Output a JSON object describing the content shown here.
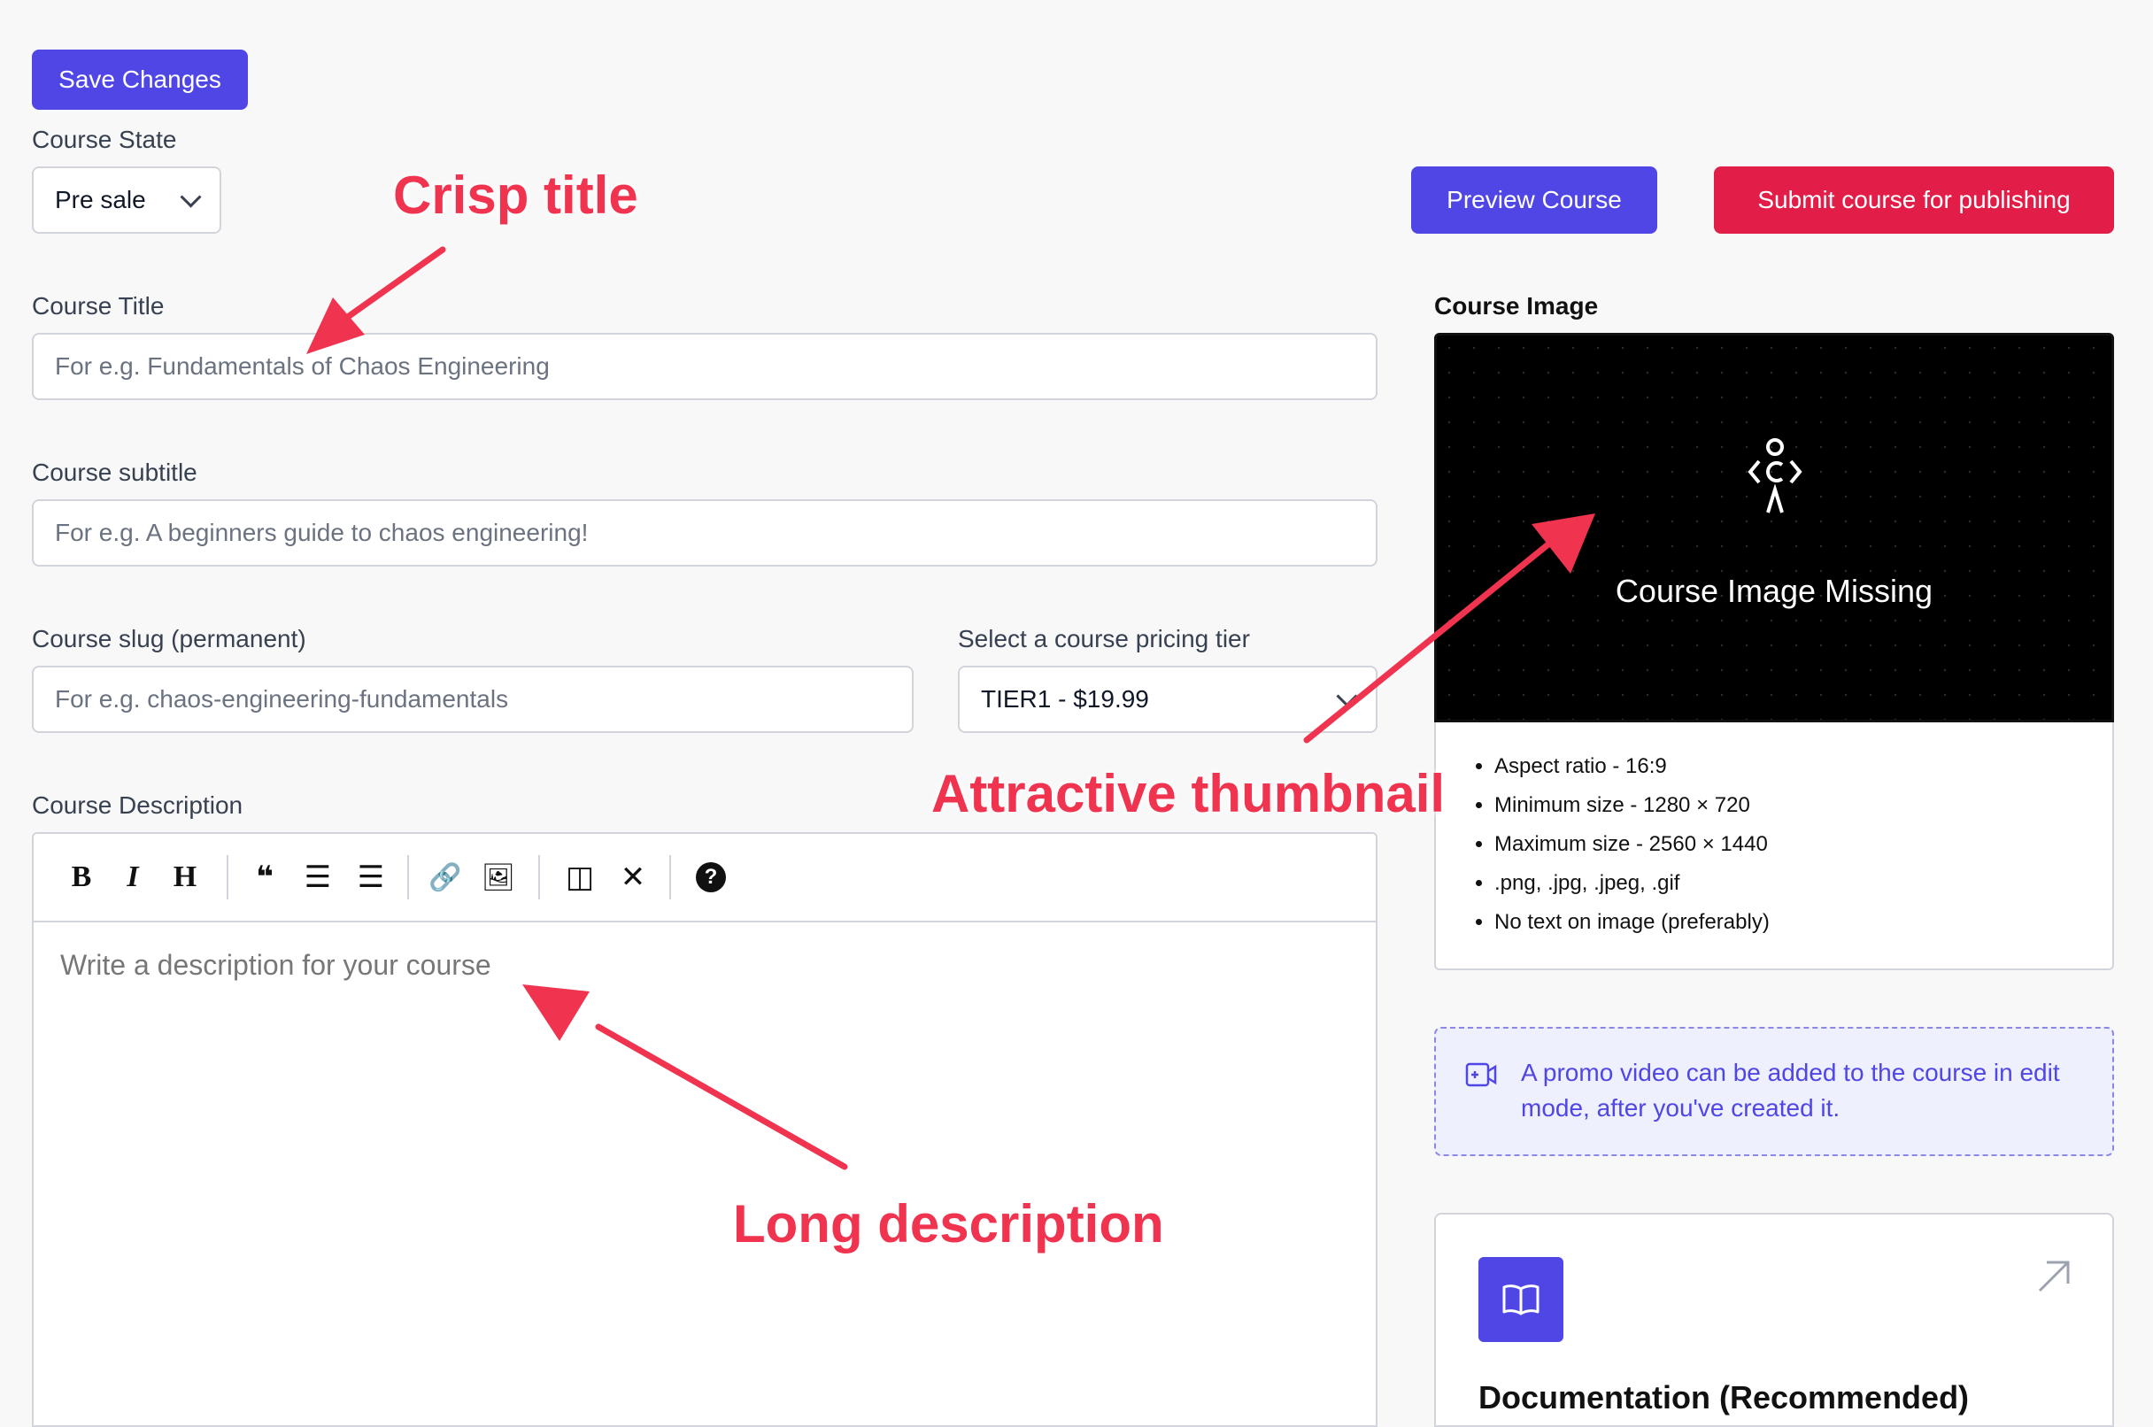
{
  "toolbar": {
    "save_label": "Save Changes"
  },
  "course_state": {
    "label": "Course State",
    "value": "Pre sale"
  },
  "actions": {
    "preview_label": "Preview Course",
    "submit_label": "Submit course for publishing"
  },
  "fields": {
    "title": {
      "label": "Course Title",
      "placeholder": "For e.g. Fundamentals of Chaos Engineering"
    },
    "subtitle": {
      "label": "Course subtitle",
      "placeholder": "For e.g. A beginners guide to chaos engineering!"
    },
    "slug": {
      "label": "Course slug (permanent)",
      "placeholder": "For e.g. chaos-engineering-fundamentals"
    },
    "pricing": {
      "label": "Select a course pricing tier",
      "value": "TIER1 - $19.99"
    },
    "description": {
      "label": "Course Description",
      "placeholder": "Write a description for your course"
    }
  },
  "editor_tools": [
    {
      "name": "bold",
      "glyph": "B"
    },
    {
      "name": "italic",
      "glyph": "I"
    },
    {
      "name": "heading",
      "glyph": "H"
    },
    {
      "name": "quote",
      "glyph": "❝"
    },
    {
      "name": "unordered-list",
      "glyph": "☰"
    },
    {
      "name": "ordered-list",
      "glyph": "☰"
    },
    {
      "name": "link",
      "glyph": "🔗"
    },
    {
      "name": "image",
      "glyph": "🖼"
    },
    {
      "name": "side-by-side",
      "glyph": "◫"
    },
    {
      "name": "fullscreen",
      "glyph": "✕"
    },
    {
      "name": "guide",
      "glyph": "?"
    }
  ],
  "course_image": {
    "label": "Course Image",
    "missing_text": "Course Image Missing",
    "requirements": [
      "Aspect ratio - 16:9",
      "Minimum size - 1280 × 720",
      "Maximum size - 2560 × 1440",
      ".png, .jpg, .jpeg, .gif",
      "No text on image (preferably)"
    ]
  },
  "promo": {
    "text": "A promo video can be added to the course in edit mode, after you've created it."
  },
  "docs_card": {
    "title": "Documentation (Recommended)"
  },
  "annotations": {
    "title": "Crisp title",
    "thumbnail": "Attractive thumbnail",
    "description": "Long description"
  },
  "colors": {
    "primary": "#4f46e5",
    "danger": "#e11d48",
    "annotation": "#f0334f"
  },
  "icons": [
    "book-icon",
    "arrow-up-right-icon",
    "video-plus-icon",
    "chevron-down-icon",
    "codu-logo-icon"
  ]
}
